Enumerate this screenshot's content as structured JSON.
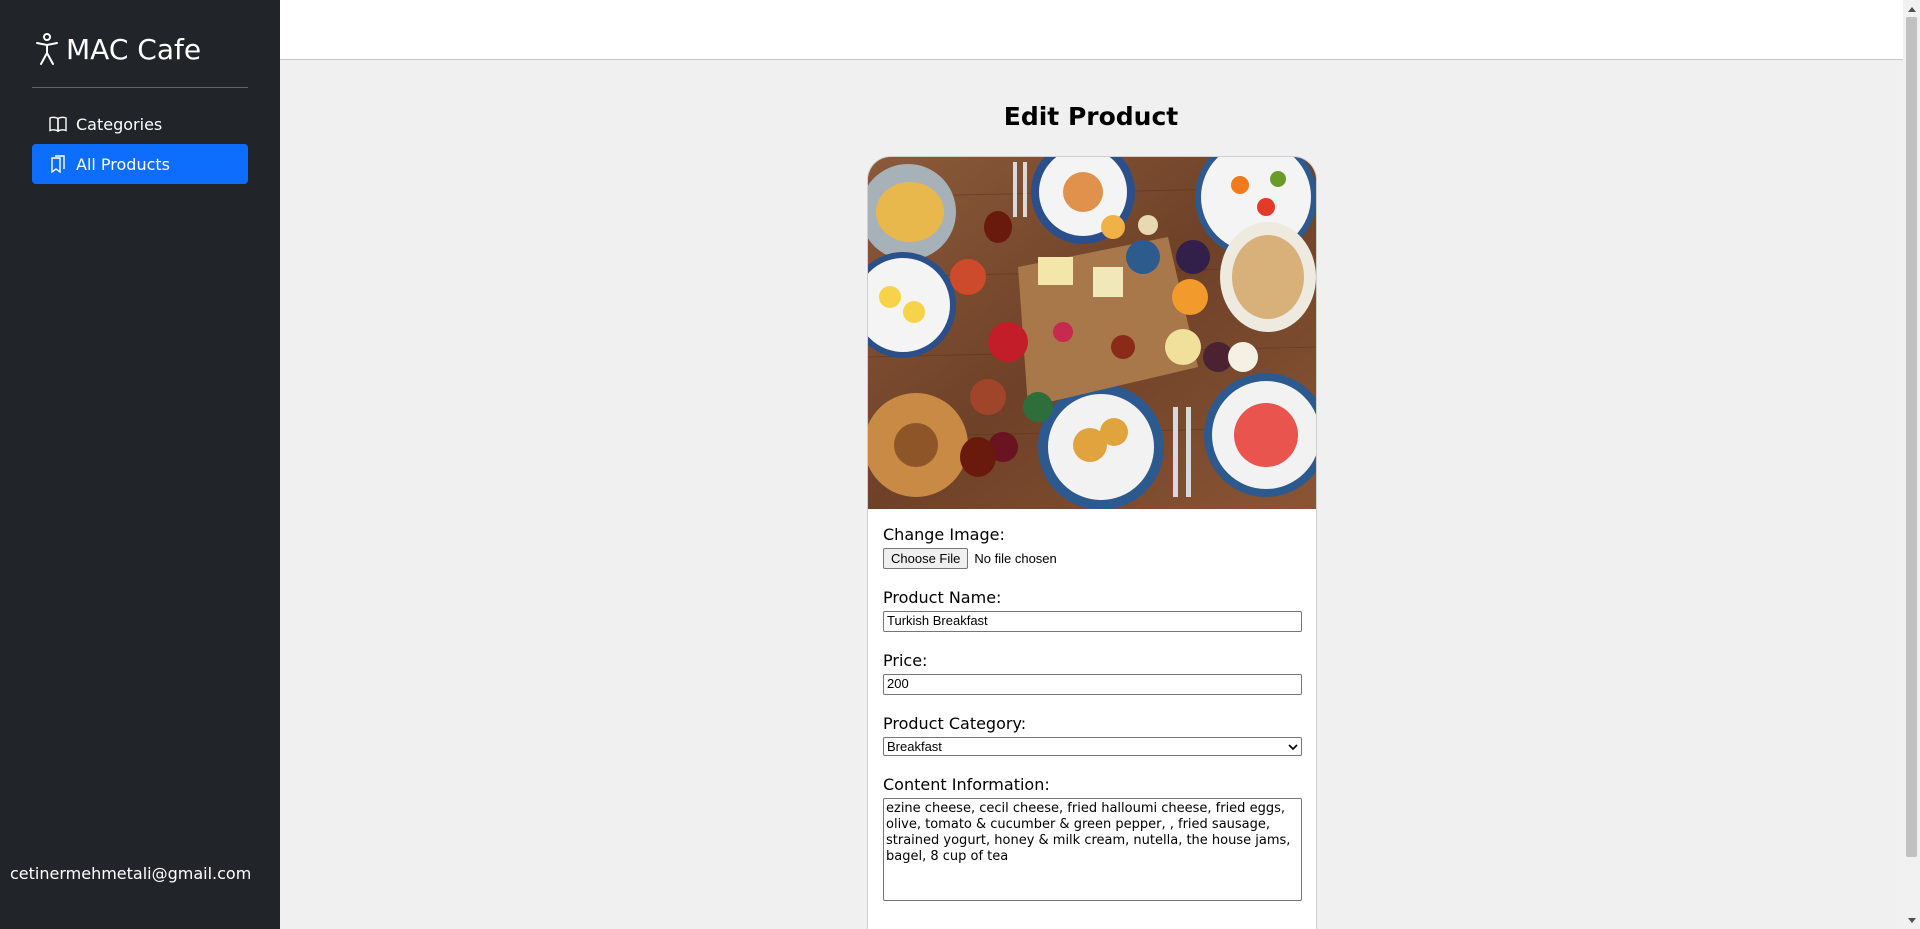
{
  "sidebar": {
    "brand": "MAC Cafe",
    "items": [
      {
        "label": "Categories",
        "icon": "book-icon",
        "active": false
      },
      {
        "label": "All Products",
        "icon": "bookmarks-icon",
        "active": true
      }
    ],
    "user_email": "cetinermehmetali@gmail.com"
  },
  "main": {
    "title": "Edit Product",
    "image_alt": "Turkish breakfast spread",
    "form": {
      "change_image_label": "Change Image:",
      "choose_file_label": "Choose File",
      "no_file_text": "No file chosen",
      "product_name_label": "Product Name:",
      "product_name_value": "Turkish Breakfast",
      "price_label": "Price:",
      "price_value": "200",
      "category_label": "Product Category:",
      "category_value": "Breakfast",
      "content_label": "Content Information:",
      "content_value": "ezine cheese, cecil cheese, fried halloumi cheese, fried eggs, olive, tomato & cucumber & green pepper,  , fried sausage, strained yogurt, honey & milk cream, nutella, the house jams, bagel, 8 cup of tea"
    }
  },
  "colors": {
    "sidebar_bg": "#212529",
    "active_item": "#0d6efd",
    "page_bg": "#f0f0f0"
  }
}
